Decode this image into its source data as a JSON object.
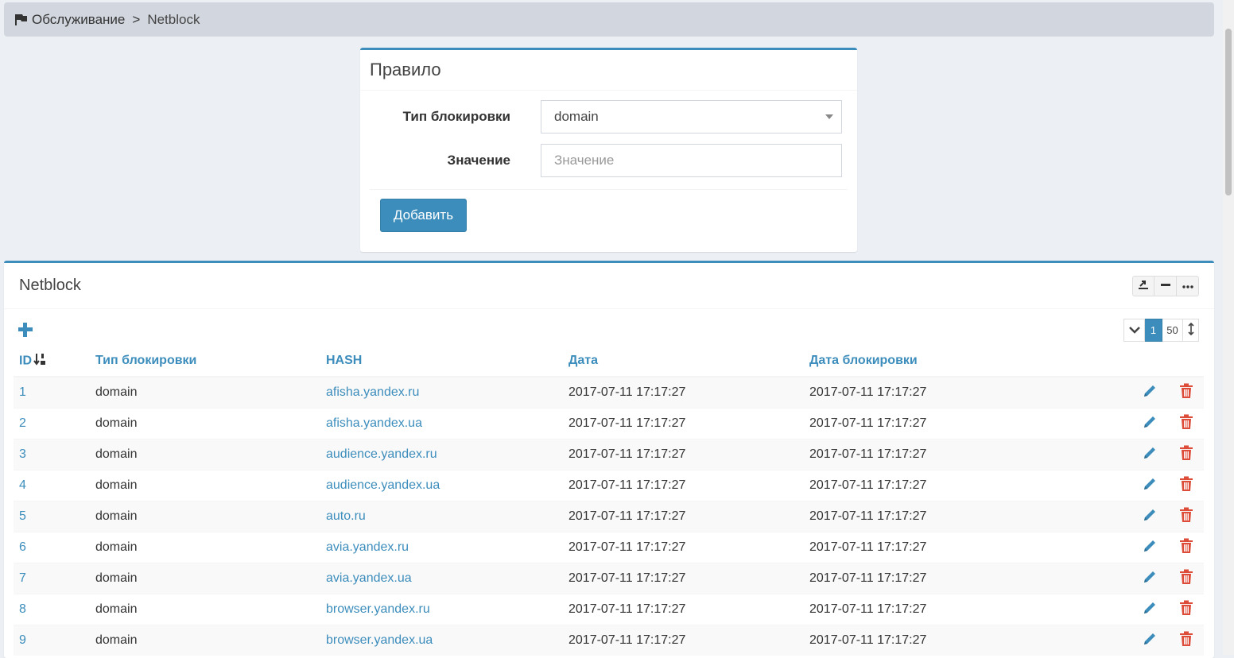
{
  "breadcrumb": {
    "section": "Обслуживание",
    "separator": ">",
    "current": "Netblock"
  },
  "rule_form": {
    "title": "Правило",
    "block_type_label": "Тип блокировки",
    "block_type_value": "domain",
    "value_label": "Значение",
    "value_placeholder": "Значение",
    "add_button": "Добавить"
  },
  "netblock": {
    "title": "Netblock",
    "pager": {
      "page": "1",
      "page_size": "50"
    },
    "columns": {
      "id": "ID",
      "type": "Тип блокировки",
      "hash": "HASH",
      "date": "Дата",
      "block_date": "Дата блокировки"
    },
    "rows": [
      {
        "id": "1",
        "type": "domain",
        "hash": "afisha.yandex.ru",
        "date": "2017-07-11 17:17:27",
        "block_date": "2017-07-11 17:17:27"
      },
      {
        "id": "2",
        "type": "domain",
        "hash": "afisha.yandex.ua",
        "date": "2017-07-11 17:17:27",
        "block_date": "2017-07-11 17:17:27"
      },
      {
        "id": "3",
        "type": "domain",
        "hash": "audience.yandex.ru",
        "date": "2017-07-11 17:17:27",
        "block_date": "2017-07-11 17:17:27"
      },
      {
        "id": "4",
        "type": "domain",
        "hash": "audience.yandex.ua",
        "date": "2017-07-11 17:17:27",
        "block_date": "2017-07-11 17:17:27"
      },
      {
        "id": "5",
        "type": "domain",
        "hash": "auto.ru",
        "date": "2017-07-11 17:17:27",
        "block_date": "2017-07-11 17:17:27"
      },
      {
        "id": "6",
        "type": "domain",
        "hash": "avia.yandex.ru",
        "date": "2017-07-11 17:17:27",
        "block_date": "2017-07-11 17:17:27"
      },
      {
        "id": "7",
        "type": "domain",
        "hash": "avia.yandex.ua",
        "date": "2017-07-11 17:17:27",
        "block_date": "2017-07-11 17:17:27"
      },
      {
        "id": "8",
        "type": "domain",
        "hash": "browser.yandex.ru",
        "date": "2017-07-11 17:17:27",
        "block_date": "2017-07-11 17:17:27"
      },
      {
        "id": "9",
        "type": "domain",
        "hash": "browser.yandex.ua",
        "date": "2017-07-11 17:17:27",
        "block_date": "2017-07-11 17:17:27"
      }
    ]
  },
  "icons": {
    "breadcrumb": "flag-icon",
    "tools": [
      "export-icon",
      "minimize-icon",
      "more-icon"
    ],
    "add": "plus-icon",
    "pager_toggle": "chevron-down-icon",
    "pager_resize": "resize-vertical-icon",
    "sort": "sort-numeric-asc-icon",
    "row_edit": "pencil-icon",
    "row_delete": "trash-icon"
  },
  "colors": {
    "accent": "#3c8dbc",
    "danger": "#dd4b39",
    "background": "#ecf0f5"
  }
}
